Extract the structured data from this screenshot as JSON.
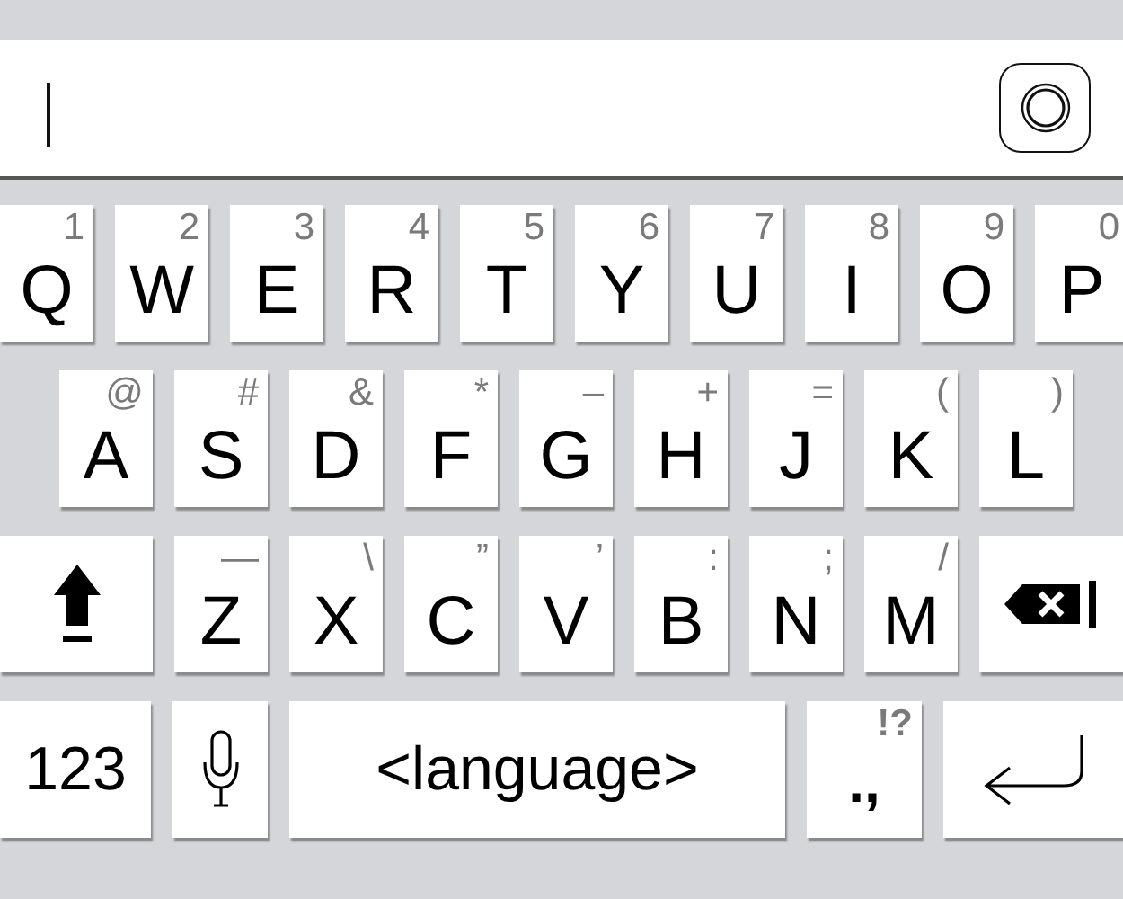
{
  "input": {
    "focused": true
  },
  "rows": [
    {
      "keys": [
        {
          "kind": "letter",
          "label": "Q",
          "hint": "1"
        },
        {
          "kind": "letter",
          "label": "W",
          "hint": "2"
        },
        {
          "kind": "letter",
          "label": "E",
          "hint": "3"
        },
        {
          "kind": "letter",
          "label": "R",
          "hint": "4"
        },
        {
          "kind": "letter",
          "label": "T",
          "hint": "5"
        },
        {
          "kind": "letter",
          "label": "Y",
          "hint": "6"
        },
        {
          "kind": "letter",
          "label": "U",
          "hint": "7"
        },
        {
          "kind": "letter",
          "label": "I",
          "hint": "8"
        },
        {
          "kind": "letter",
          "label": "O",
          "hint": "9"
        },
        {
          "kind": "letter",
          "label": "P",
          "hint": "0"
        }
      ]
    },
    {
      "keys": [
        {
          "kind": "letter",
          "label": "A",
          "hint": "@"
        },
        {
          "kind": "letter",
          "label": "S",
          "hint": "#"
        },
        {
          "kind": "letter",
          "label": "D",
          "hint": "&"
        },
        {
          "kind": "letter",
          "label": "F",
          "hint": "*"
        },
        {
          "kind": "letter",
          "label": "G",
          "hint": "–"
        },
        {
          "kind": "letter",
          "label": "H",
          "hint": "+"
        },
        {
          "kind": "letter",
          "label": "J",
          "hint": "="
        },
        {
          "kind": "letter",
          "label": "K",
          "hint": "("
        },
        {
          "kind": "letter",
          "label": "L",
          "hint": ")"
        }
      ]
    },
    {
      "keys": [
        {
          "kind": "shift"
        },
        {
          "kind": "letter",
          "label": "Z",
          "hint": "—"
        },
        {
          "kind": "letter",
          "label": "X",
          "hint": "\\"
        },
        {
          "kind": "letter",
          "label": "C",
          "hint": "”"
        },
        {
          "kind": "letter",
          "label": "V",
          "hint": "’"
        },
        {
          "kind": "letter",
          "label": "B",
          "hint": ":"
        },
        {
          "kind": "letter",
          "label": "N",
          "hint": ";"
        },
        {
          "kind": "letter",
          "label": "M",
          "hint": "/"
        },
        {
          "kind": "delete"
        }
      ]
    },
    {
      "keys": [
        {
          "kind": "numbers",
          "label": "123"
        },
        {
          "kind": "mic"
        },
        {
          "kind": "space",
          "label": "<language>"
        },
        {
          "kind": "punct",
          "label": ".,",
          "hint": "!?"
        },
        {
          "kind": "return"
        }
      ]
    }
  ]
}
